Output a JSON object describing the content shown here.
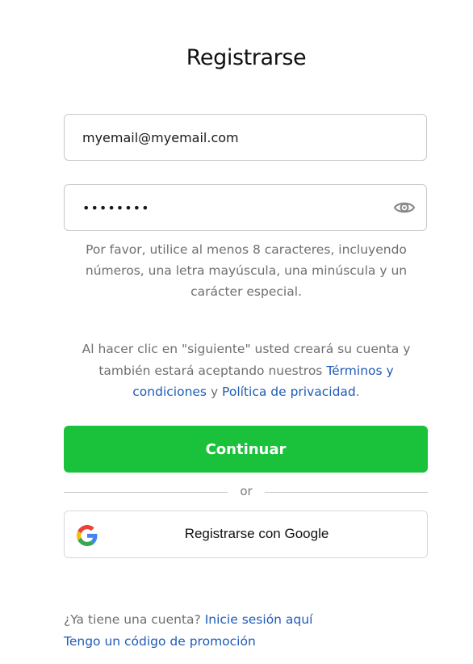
{
  "page": {
    "title": "Registrarse"
  },
  "form": {
    "email_value": "myemail@myemail.com",
    "password_value": "Passw0rd",
    "password_icon": "eye-icon",
    "hint": "Por favor, utilice al menos 8 caracteres, incluyendo números, una letra mayúscula, una minúscula y un carácter especial."
  },
  "terms": {
    "prefix": "Al hacer clic en \"siguiente\" usted creará su cuenta y también estará aceptando nuestros ",
    "terms_link": "Términos y condiciones",
    "middle": " y ",
    "privacy_link": "Política de privacidad",
    "suffix": "."
  },
  "actions": {
    "continue_label": "Continuar",
    "divider_label": "or",
    "google_label": "Registrarse con Google",
    "google_icon": "google-icon"
  },
  "footer": {
    "login_prefix": "¿Ya tiene una cuenta? ",
    "login_link": "Inicie sesión aquí",
    "promo_link": "Tengo un código de promoción"
  },
  "colors": {
    "primary_button": "#1ac23c",
    "link": "#1f5bb7",
    "muted_text": "#6f6f6f",
    "border": "#c8c8c8"
  }
}
